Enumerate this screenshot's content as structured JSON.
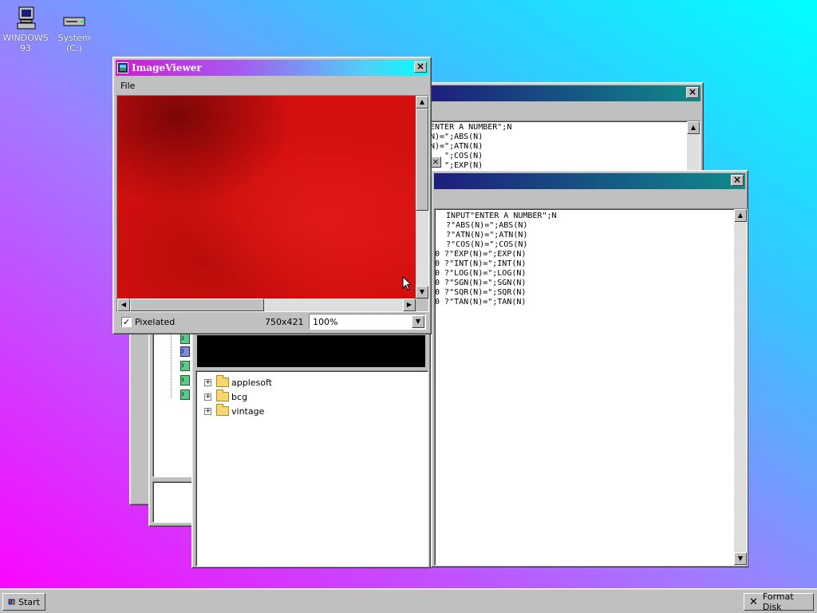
{
  "desktop": {
    "icons": [
      {
        "label": "WINDOWS 93"
      },
      {
        "label": "System (C:)"
      }
    ]
  },
  "code_window_back": {
    "lines": [
      "ENTER A NUMBER\";N",
      "N)=\";ABS(N)",
      "N)=\";ATN(N)",
      "\";COS(N)",
      "\";EXP(N)"
    ]
  },
  "code_window_front": {
    "lines": [
      "  INPUT\"ENTER A NUMBER\";N",
      "  ?\"ABS(N)=\";ABS(N)",
      "  ?\"ATN(N)=\";ATN(N)",
      "  ?\"COS(N)=\";COS(N)",
      "40 ?\"EXP(N)=\";EXP(N)",
      "50 ?\"INT(N)=\";INT(N)",
      "60 ?\"LOG(N)=\";LOG(N)",
      "70 ?\"SGN(N)=\";SGN(N)",
      "80 ?\"SQR(N)=\";SQR(N)",
      "90 ?\"TAN(N)=\";TAN(N)"
    ]
  },
  "file_tree": {
    "folders": [
      {
        "name": "applesoft"
      },
      {
        "name": "bcg"
      },
      {
        "name": "vintage"
      }
    ]
  },
  "image_viewer": {
    "title": "ImageViewer",
    "menu_file": "File",
    "pixelated_label": "Pixelated",
    "pixelated_checked": true,
    "dimensions": "750x421",
    "zoom": "100%",
    "image_color": "#d4100f"
  },
  "taskbar": {
    "start_label": "Start",
    "format_disk_label": "Format Disk"
  }
}
